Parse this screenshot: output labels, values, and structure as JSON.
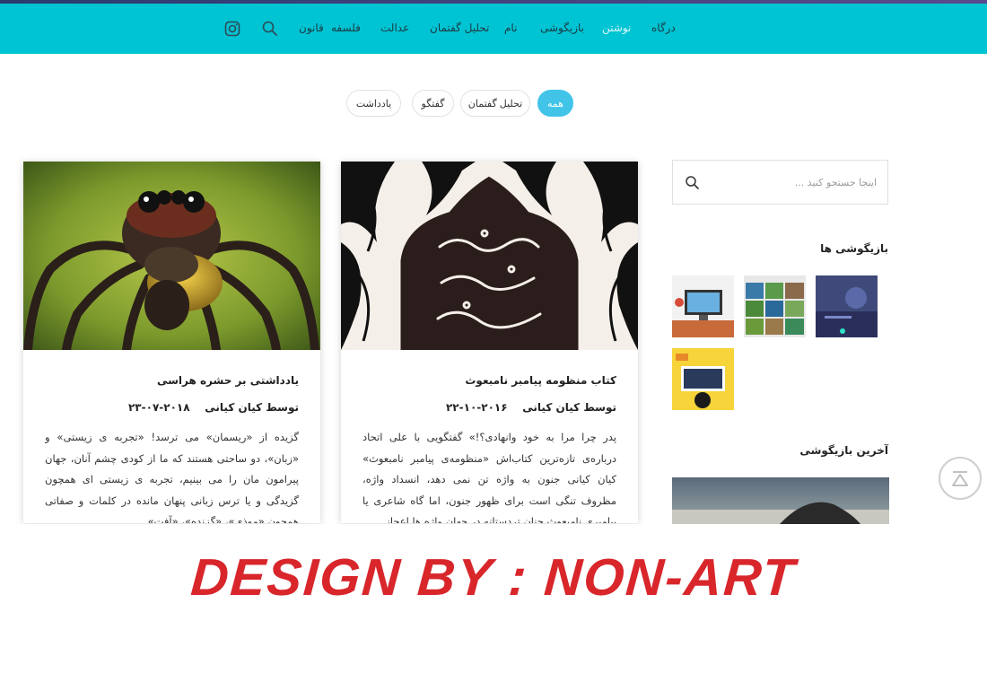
{
  "nav": {
    "items": [
      {
        "label": "درگاه"
      },
      {
        "label": "نوشتن"
      },
      {
        "label": "بازیگوشی"
      },
      {
        "label": "نام"
      },
      {
        "label": "تحلیل گفتمان"
      },
      {
        "label": "عدالت"
      },
      {
        "label": "فلسفه"
      },
      {
        "label": "قانون"
      }
    ],
    "active_index": 1,
    "icons": [
      "search-icon",
      "instagram-icon"
    ]
  },
  "filters": [
    {
      "label": "همه",
      "active": true
    },
    {
      "label": "تحلیل گفتمان",
      "active": false
    },
    {
      "label": "گفتگو",
      "active": false
    },
    {
      "label": "یادداشت",
      "active": false
    }
  ],
  "posts": [
    {
      "title": "کتاب منظومه پیامبر نامبعوث",
      "author_prefix": "توسط",
      "author": "کیان کیانی",
      "date": "۲۰۱۶-۱۰-۲۲",
      "excerpt": "پدر چرا مرا به خود وانهادی؟!» گفتگویی با علی اتحاد درباره‌ی تازه‌ترین کتاب‌اش «منظومه‌ی پیامبر نامبعوث» کیان کیانی جنون به واژه تن نمی دهد، انسداد واژه، مظروف تنگی است برای ظهور جنون، اما گاه شاعری یا پیامبری نامبعوث چنان تردستانه در جهان واژه ها اعجاز..."
    },
    {
      "title": "یادداشتی بر حشره هراسی",
      "author_prefix": "توسط",
      "author": "کیان کیانی",
      "date": "۲۰۱۸-۰۷-۲۳",
      "excerpt": "گزیده از «ریسمان» می ترسد! «تجربه ی زیستی» و «زبان»، دو ساحتی هستند که ما از کودی چشم آنان، جهان پیرامون مان را می بینیم، تجربه ی زیستی ای همچون گزیدگی و یا ترس زبانی پنهان مانده در کلمات و صفاتی همچون «موذی»، «گزنده»، «آفت»..."
    }
  ],
  "sidebar": {
    "search_placeholder": "اینجا جستجو کنید ...",
    "games_title": "بازیگوشی ها",
    "latest_title": "آخرین بازیگوشی"
  },
  "banner": {
    "text": "DESIGN BY : NON-ART"
  },
  "colors": {
    "nav_bg": "#00c4d3",
    "pill_active": "#41c4e8",
    "banner_text": "#d8262b"
  }
}
